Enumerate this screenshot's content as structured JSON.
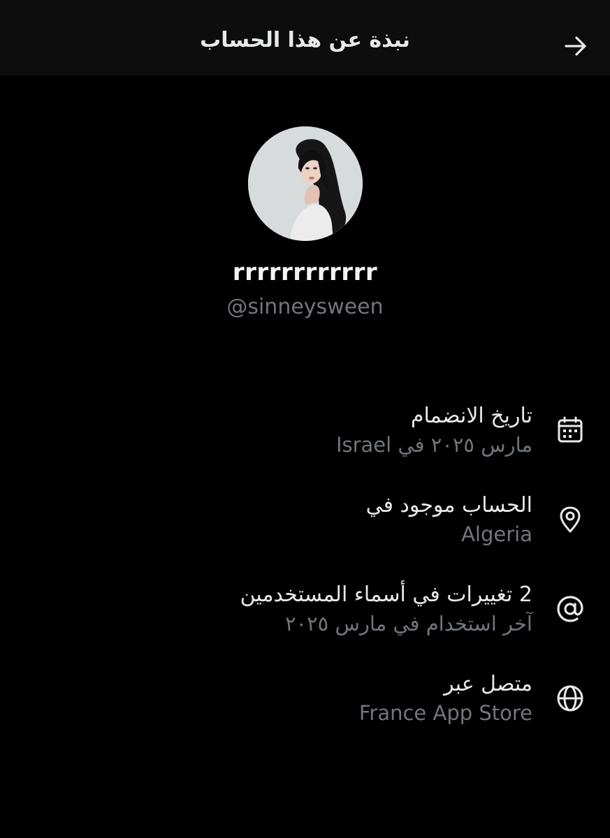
{
  "header": {
    "title": "نبذة عن هذا الحساب",
    "back_icon": "arrow-right-icon"
  },
  "profile": {
    "display_name": "rrrrrrrrrrrr",
    "handle": "@sinneysween",
    "avatar_icon": "profile-photo"
  },
  "details": [
    {
      "icon": "calendar-icon",
      "title": "تاريخ الانضمام",
      "subtitle": "مارس ٢٠٢٥ في Israel"
    },
    {
      "icon": "location-pin-icon",
      "title": "الحساب موجود في",
      "subtitle": "Algeria"
    },
    {
      "icon": "at-sign-icon",
      "title": "2 تغييرات في أسماء المستخدمين",
      "subtitle": "آخر استخدام في مارس ٢٠٢٥"
    },
    {
      "icon": "globe-icon",
      "title": "متصل عبر",
      "subtitle": "France App Store"
    }
  ],
  "colors": {
    "background": "#000000",
    "header_background": "#0d0d0d",
    "primary_text": "#e7e9ea",
    "secondary_text": "#71767b"
  }
}
